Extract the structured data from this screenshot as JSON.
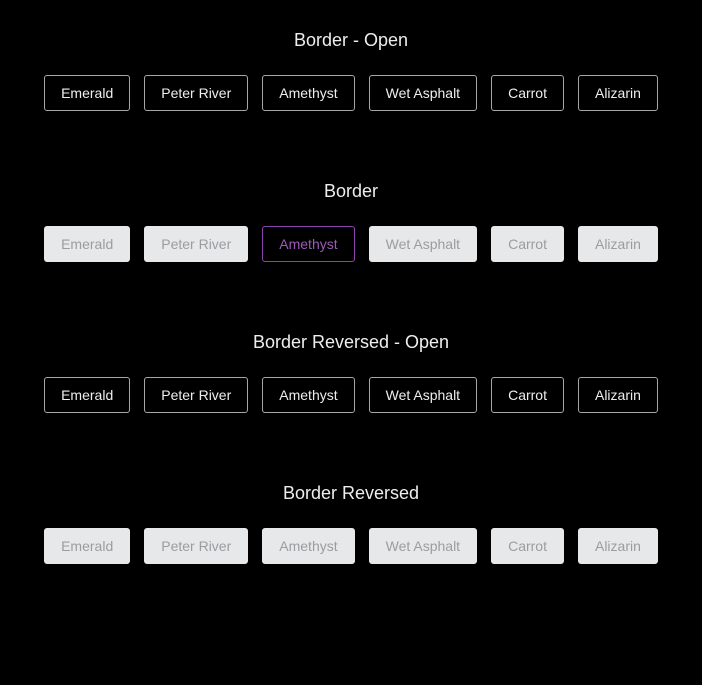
{
  "sections": [
    {
      "title": "Border - Open",
      "style": "open",
      "buttons": [
        "Emerald",
        "Peter River",
        "Amethyst",
        "Wet Asphalt",
        "Carrot",
        "Alizarin"
      ]
    },
    {
      "title": "Border",
      "style": "filled",
      "buttons": [
        "Emerald",
        "Peter River",
        "Amethyst",
        "Wet Asphalt",
        "Carrot",
        "Alizarin"
      ],
      "highlight_index": 2
    },
    {
      "title": "Border Reversed - Open",
      "style": "open",
      "buttons": [
        "Emerald",
        "Peter River",
        "Amethyst",
        "Wet Asphalt",
        "Carrot",
        "Alizarin"
      ]
    },
    {
      "title": "Border Reversed",
      "style": "filled",
      "buttons": [
        "Emerald",
        "Peter River",
        "Amethyst",
        "Wet Asphalt",
        "Carrot",
        "Alizarin"
      ]
    }
  ]
}
